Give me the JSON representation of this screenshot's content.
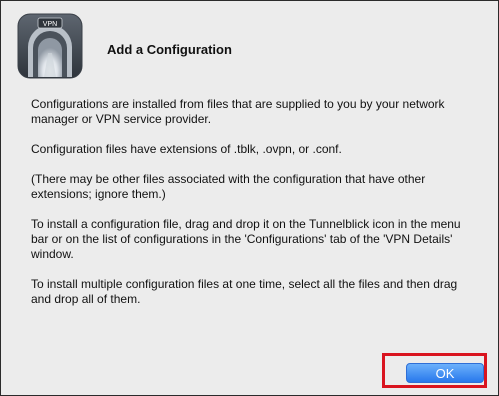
{
  "dialog": {
    "title": "Add a Configuration",
    "icon": "tunnelblick-vpn-icon",
    "icon_badge": "VPN",
    "paragraphs": [
      "Configurations are installed from files that are supplied to you by your network manager or VPN service provider.",
      "Configuration files have extensions of .tblk, .ovpn, or .conf.",
      "(There may be other files associated with the configuration that have other extensions; ignore them.)",
      "To install a configuration file, drag and drop it on the Tunnelblick icon in the menu bar or on the list of configurations in the 'Configurations' tab of the 'VPN Details' window.",
      "To install multiple configuration files at one time, select all the files and then drag and drop all of them."
    ],
    "ok_label": "OK"
  },
  "colors": {
    "dialog_background": "#ececec",
    "button_blue": "#2878ec",
    "highlight_red": "#d9141f"
  }
}
